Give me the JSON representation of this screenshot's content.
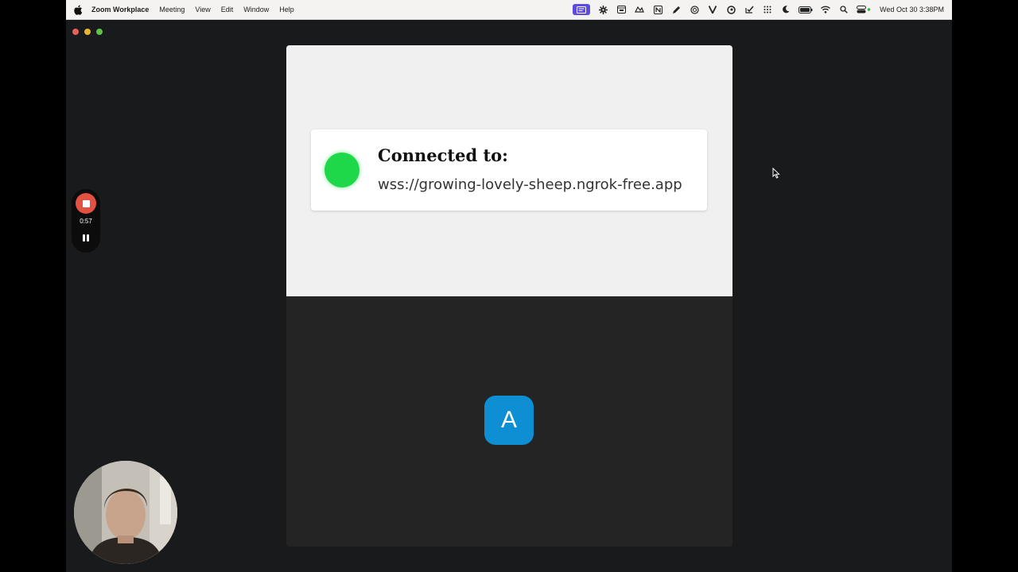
{
  "menubar": {
    "app_name": "Zoom Workplace",
    "menus": [
      "Meeting",
      "View",
      "Edit",
      "Window",
      "Help"
    ],
    "status_icons": [
      "screen-record-icon",
      "gear-icon",
      "calendar-icon",
      "app-icon",
      "notion-icon",
      "pen-icon",
      "openai-icon",
      "v-icon",
      "g-icon",
      "check-icon",
      "grid-icon",
      "moon-icon",
      "battery-icon",
      "wifi-icon",
      "search-icon",
      "control-center-icon"
    ],
    "clock": "Wed Oct 30  3:38PM"
  },
  "recording": {
    "elapsed": "0:57"
  },
  "share": {
    "status_color": "#1fd84a",
    "title": "Connected to:",
    "url": "wss://growing-lovely-sheep.ngrok-free.app"
  },
  "participant": {
    "initial": "A",
    "avatar_color": "#0e8fd3"
  }
}
